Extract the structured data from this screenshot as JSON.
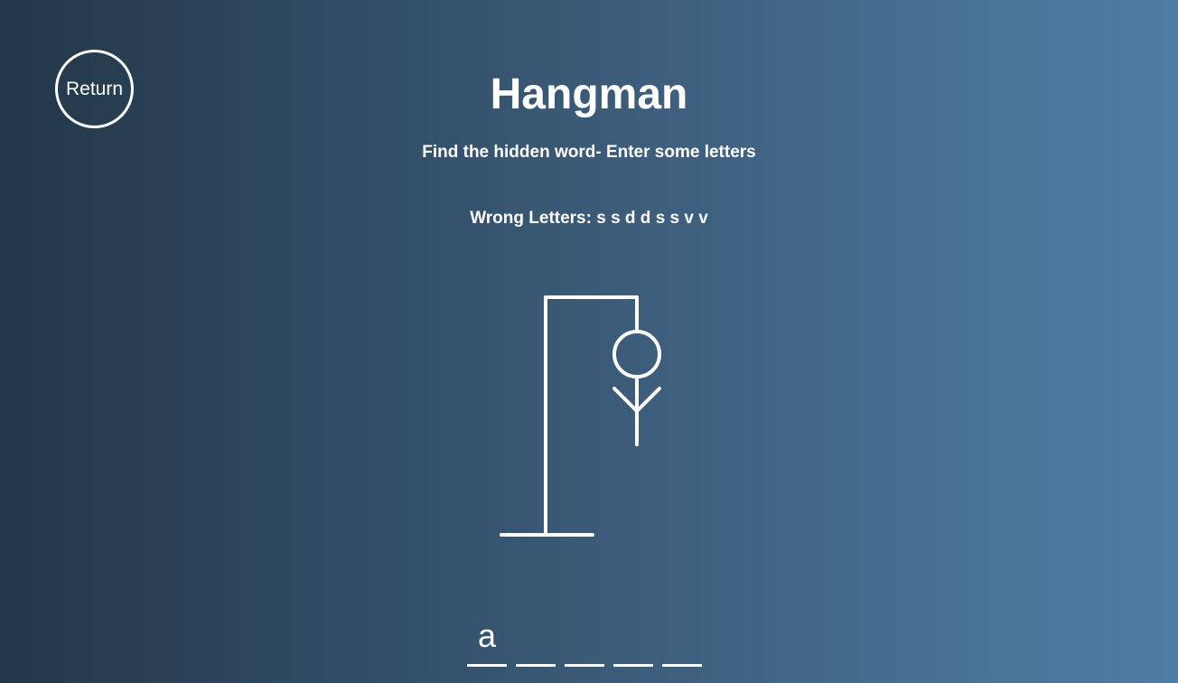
{
  "return_label": "Return",
  "title": "Hangman",
  "subtitle": "Find the hidden word- Enter some letters",
  "wrong_letters_label": "Wrong Letters:",
  "wrong_letters": "s s d d s s v v",
  "word_slots": [
    "a",
    "",
    "",
    "",
    ""
  ],
  "colors": {
    "gradient_left": "#233748",
    "gradient_right": "#4f7ca3",
    "foreground": "#ffffff"
  }
}
